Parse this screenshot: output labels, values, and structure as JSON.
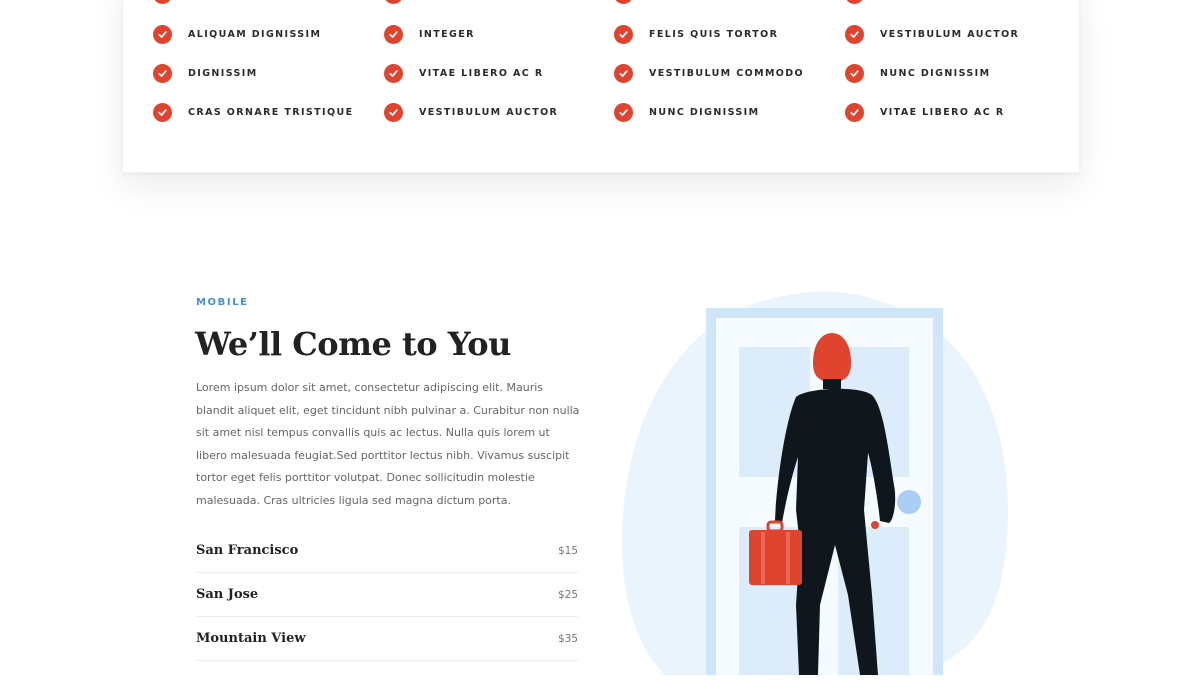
{
  "features": {
    "columns": [
      [
        "ALIQUAM DIGNISSIM",
        "DIGNISSIM",
        "CRAS ORNARE TRISTIQUE"
      ],
      [
        "INTEGER",
        "VITAE LIBERO AC R",
        "VESTIBULUM AUCTOR"
      ],
      [
        "FELIS QUIS TORTOR",
        "VESTIBULUM COMMODO",
        "NUNC DIGNISSIM"
      ],
      [
        "VESTIBULUM AUCTOR",
        "NUNC DIGNISSIM",
        "VITAE LIBERO AC R"
      ]
    ],
    "check_color": "#e0442e"
  },
  "mobile": {
    "eyebrow": "MOBILE",
    "heading": "We’ll Come to You",
    "body": "Lorem ipsum dolor sit amet, consectetur adipiscing elit. Mauris blandit aliquet elit, eget tincidunt nibh pulvinar a. Curabitur non nulla sit amet nisl tempus convallis quis ac lectus. Nulla quis lorem ut libero malesuada feugiat.Sed porttitor lectus nibh. Vivamus suscipit tortor eget felis porttitor volutpat. Donec sollicitudin molestie malesuada. Cras ultricies ligula sed magna dictum porta.",
    "prices": [
      {
        "city": "San Francisco",
        "price": "$15"
      },
      {
        "city": "San Jose",
        "price": "$25"
      },
      {
        "city": "Mountain View",
        "price": "$35"
      }
    ],
    "accent_color": "#4a8fd6"
  },
  "illustration": {
    "icon": "person-with-briefcase-at-door-illustration"
  }
}
